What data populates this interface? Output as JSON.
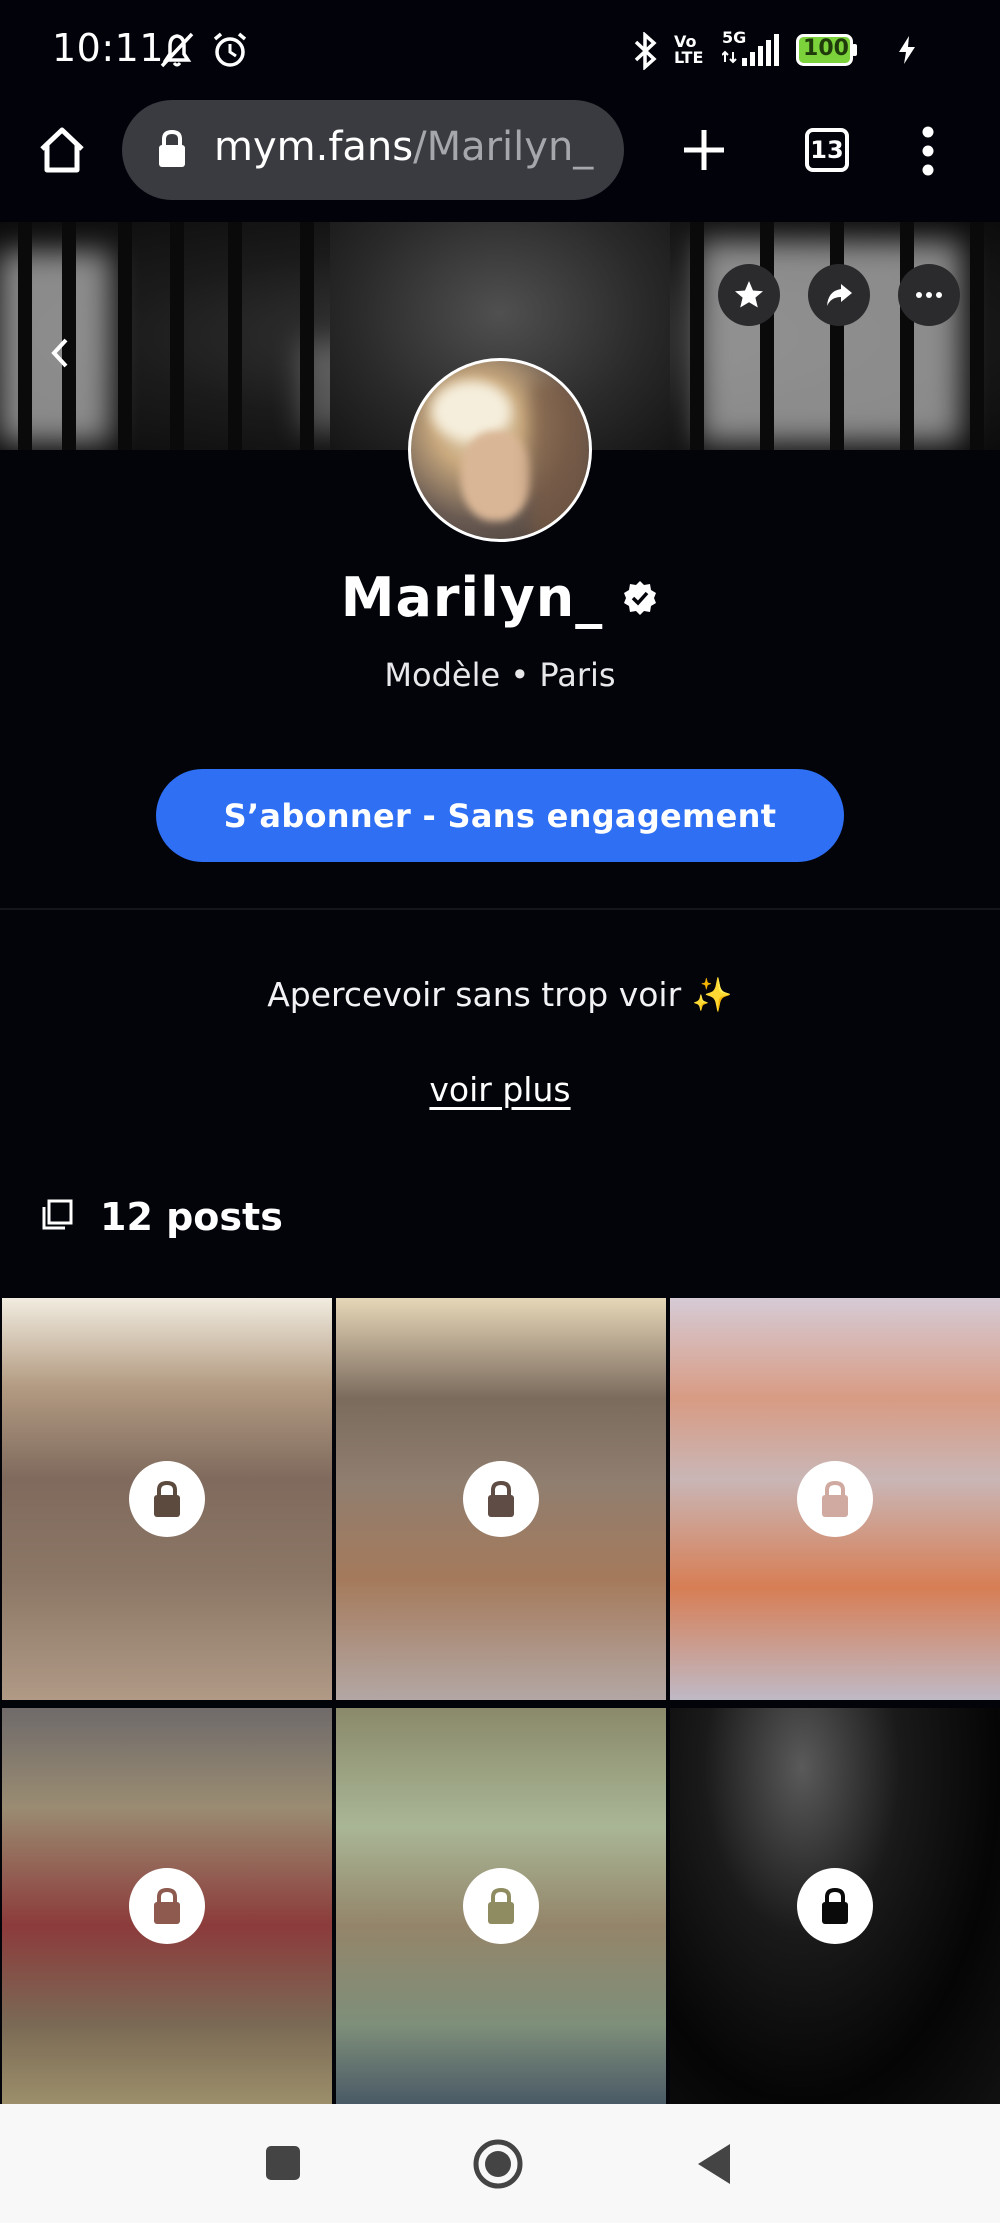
{
  "status_bar": {
    "time": "10:11",
    "network_label": "5G",
    "volte_label_top": "Vo",
    "volte_label_bottom": "LTE",
    "battery": "100"
  },
  "browser": {
    "url_host": "mym.fans",
    "url_path": "/Marilyn_",
    "tab_count": "13"
  },
  "profile": {
    "name": "Marilyn_",
    "subtitle": "Modèle • Paris",
    "subscribe_label": "S’abonner - Sans engagement",
    "bio": "Apercevoir sans trop voir ✨",
    "see_more_label": "voir plus",
    "posts_label": "12 posts"
  },
  "colors": {
    "accent": "#2E6FF3",
    "background": "#03040A",
    "battery": "#7BD23A"
  }
}
